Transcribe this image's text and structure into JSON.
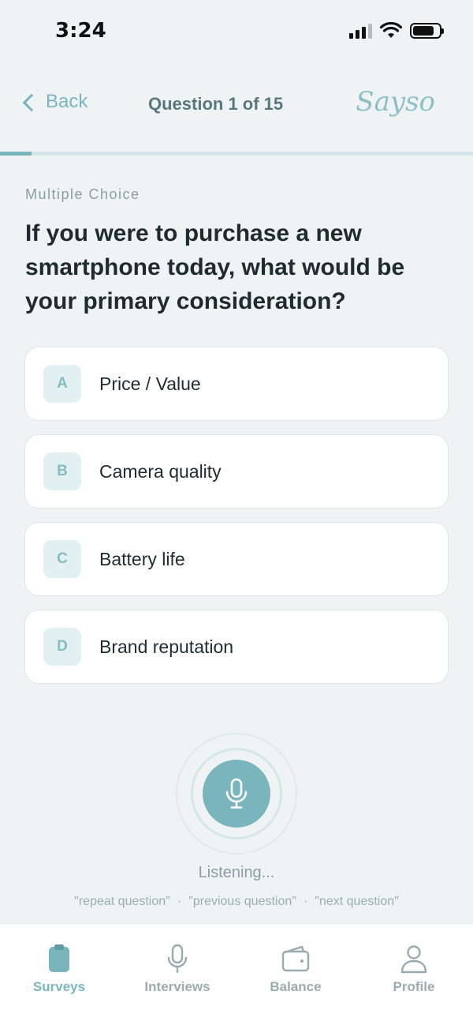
{
  "status_bar": {
    "time": "3:24",
    "icons": [
      "signal-icon",
      "wifi-icon",
      "battery-icon"
    ]
  },
  "header": {
    "back_label": "Back",
    "question_counter": "Question 1 of 15",
    "brand": "Sayso"
  },
  "progress": {
    "current": 1,
    "total": 15,
    "fraction": 0.067
  },
  "question": {
    "type": "Multiple Choice",
    "text": "If you were to purchase a new smartphone today, what would be your primary consideration?",
    "options": [
      {
        "key": "A",
        "label": "Price / Value"
      },
      {
        "key": "B",
        "label": "Camera quality"
      },
      {
        "key": "C",
        "label": "Battery life"
      },
      {
        "key": "D",
        "label": "Brand reputation"
      }
    ]
  },
  "voice": {
    "status": "Listening...",
    "commands": [
      "\"repeat question\"",
      "\"previous question\"",
      "\"next question\""
    ],
    "separator": "·"
  },
  "tabs": [
    {
      "label": "Surveys",
      "icon": "clipboard-icon",
      "active": true
    },
    {
      "label": "Interviews",
      "icon": "microphone-icon",
      "active": false
    },
    {
      "label": "Balance",
      "icon": "wallet-icon",
      "active": false
    },
    {
      "label": "Profile",
      "icon": "person-icon",
      "active": false
    }
  ],
  "colors": {
    "accent": "#7ab5bd",
    "background": "#eff3f4",
    "text_dark": "#1f2b2e",
    "muted": "#8a9ea3"
  }
}
